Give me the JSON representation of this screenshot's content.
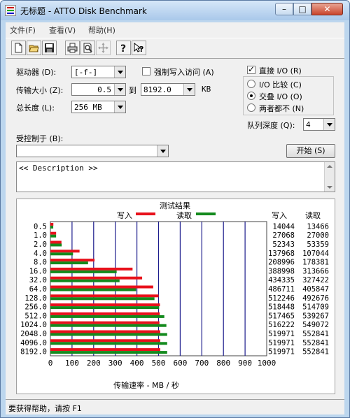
{
  "window": {
    "title": "无标题 - ATTO Disk Benchmark",
    "close_label": "✕",
    "max_label": "□",
    "min_label": "–"
  },
  "menu": [
    {
      "label": "文件(F)"
    },
    {
      "label": "查看(V)"
    },
    {
      "label": "帮助(H)"
    }
  ],
  "toolbar": {
    "buttons": [
      "new-icon",
      "open-icon",
      "save-icon",
      "print-icon",
      "print-preview-icon",
      "move-icon",
      "help-icon",
      "context-help-icon"
    ]
  },
  "settings": {
    "drive_label": "驱动器 (D):",
    "drive_value": "[-f-]",
    "force_write_label": "强制写入访问 (A)",
    "transfer_label": "传输大小 (Z):",
    "transfer_from": "0.5",
    "to_label": "到",
    "transfer_to": "8192.0",
    "kb_label": "KB",
    "length_label": "总长度 (L):",
    "length_value": "256 MB",
    "direct_io_label": "直接 I/O (R)",
    "io_compare_label": "I/O 比较 (C)",
    "overlapped_io_label": "交叠 I/O (O)",
    "neither_label": "两者都不 (N)",
    "queue_depth_label": "队列深度 (Q):",
    "queue_depth_value": "4",
    "controlled_by_label": "受控制于 (B):",
    "controlled_by_value": "",
    "start_label": "开始 (S)",
    "description": "<< Description >>"
  },
  "results": {
    "title": "测试结果",
    "legend_write": "写入",
    "legend_read": "读取",
    "col_write": "写入",
    "col_read": "读取",
    "xlabel": "传输速率 - MB / 秒"
  },
  "chart_data": {
    "type": "bar",
    "title": "测试结果",
    "xlabel": "传输速率 - MB / 秒",
    "xlim": [
      0,
      1000
    ],
    "xticks": [
      0,
      100,
      200,
      300,
      400,
      500,
      600,
      700,
      800,
      900,
      1000
    ],
    "categories": [
      "0.5",
      "1.0",
      "2.0",
      "4.0",
      "8.0",
      "16.0",
      "32.0",
      "64.0",
      "128.0",
      "256.0",
      "512.0",
      "1024.0",
      "2048.0",
      "4096.0",
      "8192.0"
    ],
    "series": [
      {
        "name": "写入",
        "color": "#e8111b",
        "values": [
          14044,
          27068,
          52343,
          137968,
          208996,
          388998,
          434335,
          486711,
          512246,
          518448,
          517465,
          516222,
          519971,
          519971,
          519971
        ]
      },
      {
        "name": "读取",
        "color": "#138a1d",
        "values": [
          13466,
          27000,
          53359,
          107044,
          178381,
          313666,
          327422,
          405847,
          492676,
          514709,
          539267,
          549072,
          552841,
          552841,
          552841
        ]
      }
    ]
  },
  "status": {
    "text": "要获得帮助，请按 F1"
  },
  "colors": {
    "grid": "#1c1c8c",
    "write": "#e8111b",
    "read": "#138a1d",
    "frame": "#bcd6ee"
  }
}
